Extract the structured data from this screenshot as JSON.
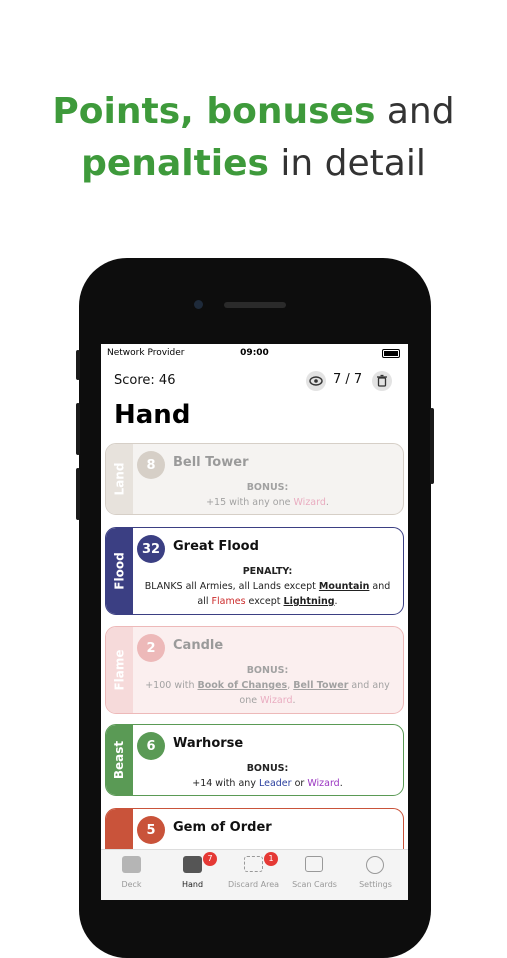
{
  "headline": {
    "line1_green": "Points, bonuses",
    "line1_rest": " and",
    "line2_green": "penalties",
    "line2_rest": " in detail"
  },
  "status_bar": {
    "provider": "Network Provider",
    "time": "09:00"
  },
  "top_bar": {
    "score": "Score: 46",
    "count": "7 / 7",
    "eye_icon": "eye-icon",
    "trash_icon": "trash-icon"
  },
  "page_title": "Hand",
  "cards": [
    {
      "suit": "Land",
      "number": "8",
      "name": "Bell Tower",
      "label": "BONUS:",
      "text_a": "+15 with any one ",
      "text_b": "Wizard",
      "text_c": ".",
      "color": "#9e8f7c",
      "dimmed": true
    },
    {
      "suit": "Flood",
      "number": "32",
      "name": "Great Flood",
      "label": "PENALTY:",
      "line1": "BLANKS all Armies, all Lands except ",
      "line1_b": "Mountain",
      "line1_c": " and",
      "line2_a": "all ",
      "line2_b": "Flames",
      "line2_c": " except ",
      "line2_d": "Lightning",
      "line2_e": ".",
      "color": "#3b3f83",
      "dimmed": false
    },
    {
      "suit": "Flame",
      "number": "2",
      "name": "Candle",
      "label": "BONUS:",
      "line1_a": "+100 with ",
      "line1_b": "Book of Changes",
      "line1_c": ", ",
      "line1_d": "Bell Tower",
      "line1_e": " and any",
      "line2_a": "one ",
      "line2_b": "Wizard",
      "line2_c": ".",
      "color": "#d65a5a",
      "dimmed": true
    },
    {
      "suit": "Beast",
      "number": "6",
      "name": "Warhorse",
      "label": "BONUS:",
      "text_a": "+14 with any ",
      "text_b": "Leader",
      "text_c": " or ",
      "text_d": "Wizard",
      "text_e": ".",
      "color": "#5a9a55",
      "dimmed": false
    },
    {
      "suit": "",
      "number": "5",
      "name": "Gem of Order",
      "color": "#c9533a",
      "dimmed": false
    }
  ],
  "tabs": [
    {
      "label": "Deck",
      "icon": "deck-icon",
      "badge": ""
    },
    {
      "label": "Hand",
      "icon": "hand-icon",
      "badge": "7"
    },
    {
      "label": "Discard Area",
      "icon": "discard-icon",
      "badge": "1"
    },
    {
      "label": "Scan Cards",
      "icon": "camera-icon",
      "badge": ""
    },
    {
      "label": "Settings",
      "icon": "gear-icon",
      "badge": ""
    }
  ]
}
